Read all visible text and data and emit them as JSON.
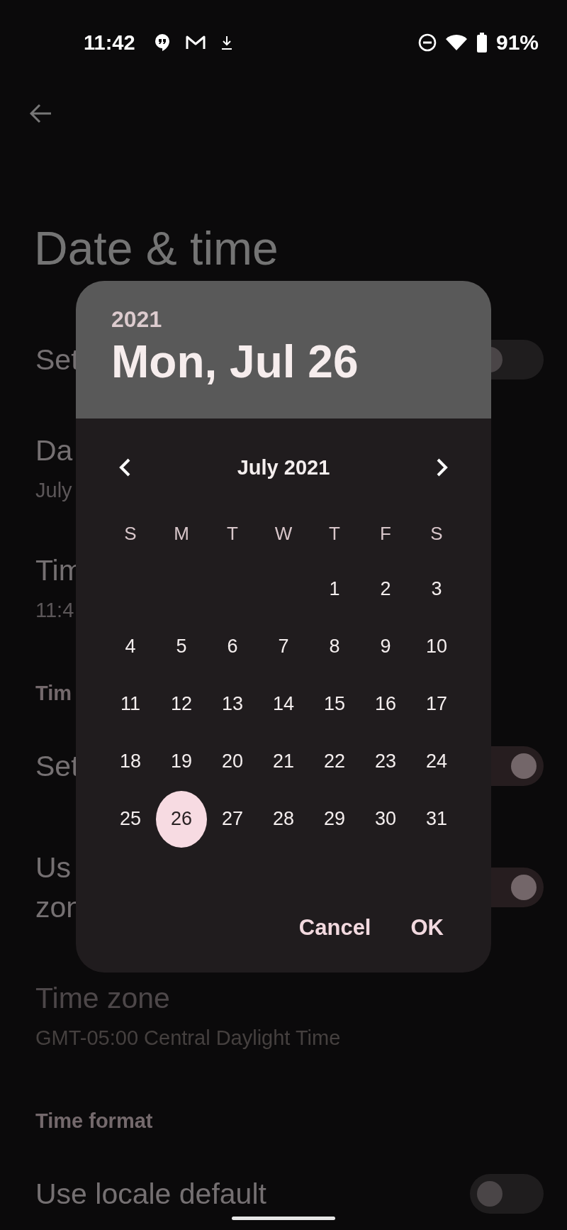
{
  "status_bar": {
    "time": "11:42",
    "battery": "91%"
  },
  "page": {
    "title": "Date & time",
    "items": [
      {
        "kind": "switch",
        "lines": [
          "Set"
        ],
        "on": false,
        "disabled": false
      },
      {
        "kind": "detail",
        "title": "Da",
        "subtitle": "July",
        "disabled": false
      },
      {
        "kind": "detail",
        "title": "Tim",
        "subtitle": "11:4",
        "disabled": false
      },
      {
        "kind": "header",
        "title": "Tim"
      },
      {
        "kind": "switch",
        "lines": [
          "Set"
        ],
        "on": true,
        "disabled": false
      },
      {
        "kind": "switch",
        "lines": [
          "Us",
          "zon"
        ],
        "on": true,
        "disabled": false
      },
      {
        "kind": "detail",
        "title": "Time zone",
        "subtitle": "GMT-05:00 Central Daylight Time",
        "disabled": true
      },
      {
        "kind": "header",
        "title": "Time format"
      },
      {
        "kind": "switch",
        "lines": [
          "Use locale default"
        ],
        "on": false,
        "disabled": false
      }
    ]
  },
  "dialog": {
    "year": "2021",
    "date": "Mon, Jul 26",
    "month": "July 2021",
    "weekdays": [
      "S",
      "M",
      "T",
      "W",
      "T",
      "F",
      "S"
    ],
    "weeks": [
      {
        "days": [
          {
            "label": "1",
            "selected": false
          },
          {
            "label": "2",
            "selected": false
          },
          {
            "label": "3",
            "selected": false
          }
        ]
      },
      {
        "days": [
          {
            "label": "4",
            "selected": false
          },
          {
            "label": "5",
            "selected": false
          },
          {
            "label": "6",
            "selected": false
          },
          {
            "label": "7",
            "selected": false
          },
          {
            "label": "8",
            "selected": false
          },
          {
            "label": "9",
            "selected": false
          },
          {
            "label": "10",
            "selected": false
          }
        ]
      },
      {
        "days": [
          {
            "label": "11",
            "selected": false
          },
          {
            "label": "12",
            "selected": false
          },
          {
            "label": "13",
            "selected": false
          },
          {
            "label": "14",
            "selected": false
          },
          {
            "label": "15",
            "selected": false
          },
          {
            "label": "16",
            "selected": false
          },
          {
            "label": "17",
            "selected": false
          }
        ]
      },
      {
        "days": [
          {
            "label": "18",
            "selected": false
          },
          {
            "label": "19",
            "selected": false
          },
          {
            "label": "20",
            "selected": false
          },
          {
            "label": "21",
            "selected": false
          },
          {
            "label": "22",
            "selected": false
          },
          {
            "label": "23",
            "selected": false
          },
          {
            "label": "24",
            "selected": false
          }
        ]
      },
      {
        "days": [
          {
            "label": "25",
            "selected": false
          },
          {
            "label": "26",
            "selected": true
          },
          {
            "label": "27",
            "selected": false
          },
          {
            "label": "28",
            "selected": false
          },
          {
            "label": "29",
            "selected": false
          },
          {
            "label": "30",
            "selected": false
          },
          {
            "label": "31",
            "selected": false
          }
        ]
      }
    ],
    "buttons": [
      "Cancel",
      "OK"
    ]
  }
}
